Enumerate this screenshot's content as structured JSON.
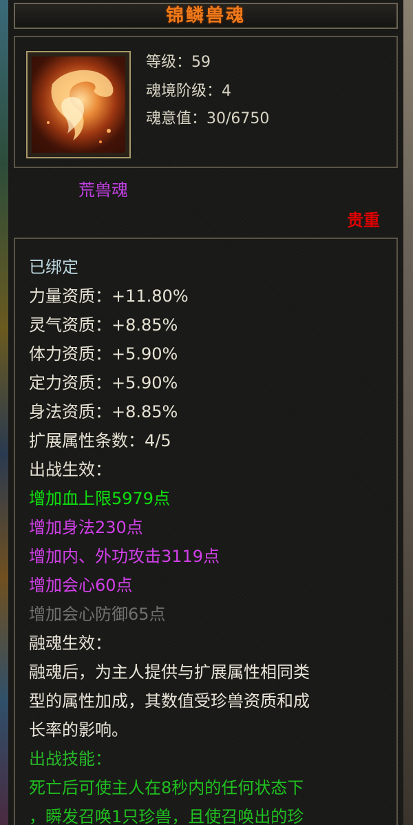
{
  "title": "锦鳞兽魂",
  "item_icon": "fire-soul-icon",
  "stats": {
    "level": "等级：59",
    "soul_rank": "魂境阶级：4",
    "soul_value": "魂意值：30/6750"
  },
  "type_label": "荒兽魂",
  "rarity_label": "贵重",
  "bound_text": "已绑定",
  "aptitudes": [
    "力量资质：+11.80%",
    "灵气资质：+8.85%",
    "体力资质：+5.90%",
    "定力资质：+5.90%",
    "身法资质：+8.85%"
  ],
  "ext_attr_count": "扩展属性条数：4/5",
  "battle_effect_heading": "出战生效：",
  "battle_effects": [
    {
      "text": "增加血上限5979点",
      "color": "#10e010"
    },
    {
      "text": "增加身法230点",
      "color": "#d040e8"
    },
    {
      "text": "增加内、外功攻击3119点",
      "color": "#d040e8"
    },
    {
      "text": "增加会心60点",
      "color": "#d040e8"
    },
    {
      "text": "增加会心防御65点",
      "color": "#707070"
    }
  ],
  "fusion_heading": "融魂生效：",
  "fusion_lines": [
    "融魂后，为主人提供与扩展属性相同类",
    "型的属性加成，其数值受珍兽资质和成",
    "长率的影响。"
  ],
  "skill_heading": "出战技能：",
  "skill_lines": [
    "死亡后可使主人在8秒内的任何状态下",
    "，瞬发召唤1只珍兽，且使召唤出的珍"
  ],
  "colors": {
    "title": "#f07a1a",
    "type": "#c040e0",
    "rarity": "#e00000",
    "green": "#10e010",
    "purple": "#d040e8",
    "gray": "#707070",
    "border": "#5a5446"
  }
}
